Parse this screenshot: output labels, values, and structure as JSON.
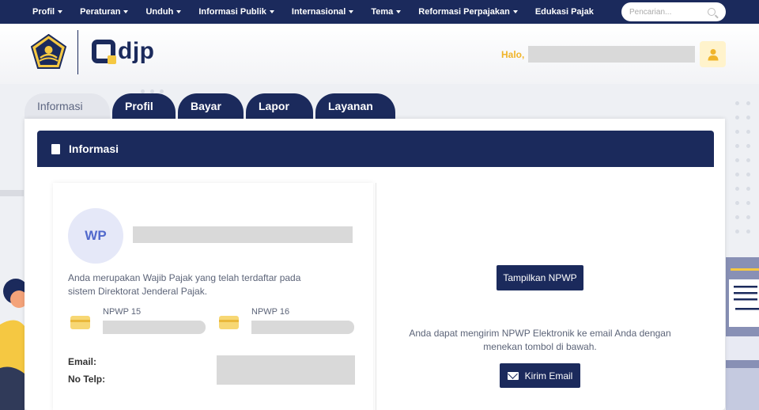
{
  "topnav": {
    "items": [
      {
        "label": "Profil",
        "dropdown": true
      },
      {
        "label": "Peraturan",
        "dropdown": true
      },
      {
        "label": "Unduh",
        "dropdown": true
      },
      {
        "label": "Informasi Publik",
        "dropdown": true
      },
      {
        "label": "Internasional",
        "dropdown": true
      },
      {
        "label": "Tema",
        "dropdown": true
      },
      {
        "label": "Reformasi Perpajakan",
        "dropdown": true
      },
      {
        "label": "Edukasi Pajak",
        "dropdown": false
      }
    ],
    "search_placeholder": "Pencarian..."
  },
  "header": {
    "brand": "djp",
    "greeting": "Halo,"
  },
  "tabs": [
    {
      "label": "Informasi",
      "active": true
    },
    {
      "label": "Profil",
      "active": false
    },
    {
      "label": "Bayar",
      "active": false
    },
    {
      "label": "Lapor",
      "active": false
    },
    {
      "label": "Layanan",
      "active": false
    }
  ],
  "card": {
    "title": "Informasi",
    "avatar_initials": "WP",
    "description": "Anda merupakan Wajib Pajak yang telah terdaftar pada sistem Direktorat Jenderal Pajak.",
    "npwp15_label": "NPWP 15",
    "npwp16_label": "NPWP 16",
    "email_label": "Email:",
    "phone_label": "No Telp:",
    "show_npwp_button": "Tampilkan NPWP",
    "email_note": "Anda dapat mengirim NPWP Elektronik ke email Anda dengan menekan tombol di bawah.",
    "send_email_button": "Kirim Email"
  },
  "colors": {
    "navy": "#1b2a5c",
    "accent_yellow": "#f0b429"
  }
}
